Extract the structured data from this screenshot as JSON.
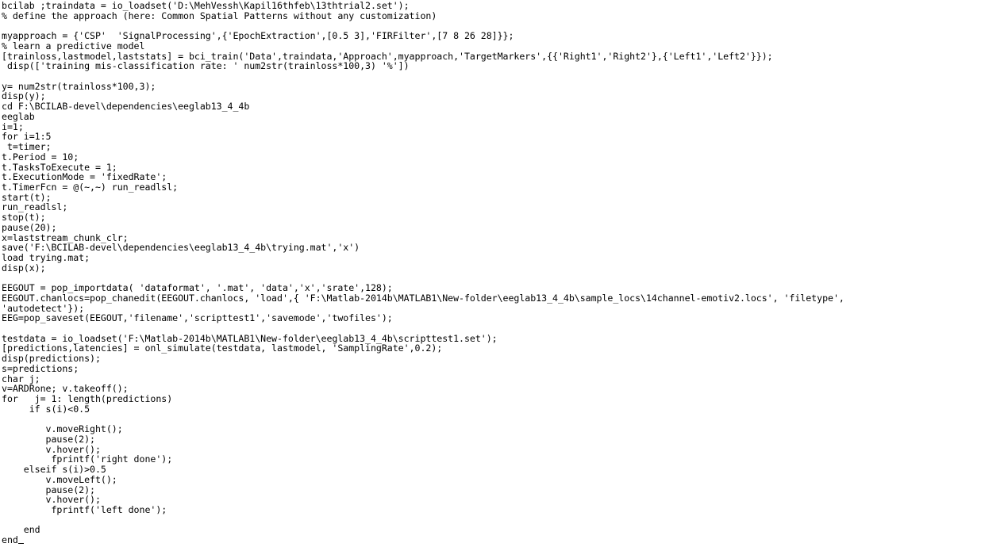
{
  "application": {
    "type": "code-editor",
    "language": "MATLAB",
    "background_color": "#ffffff",
    "text_color": "#000000",
    "font_size_px": 11.6,
    "line_height_px": 12.72
  },
  "editor": {
    "cursor": {
      "glyph": "_",
      "line_index": 53,
      "column": 3
    },
    "lines": [
      "bcilab ;traindata = io_loadset('D:\\MehVessh\\Kapil16thfeb\\13thtrial2.set');",
      "% define the approach (here: Common Spatial Patterns without any customization)",
      "",
      "myapproach = {'CSP'  'SignalProcessing',{'EpochExtraction',[0.5 3],'FIRFilter',[7 8 26 28]}};",
      "% learn a predictive model",
      "[trainloss,lastmodel,laststats] = bci_train('Data',traindata,'Approach',myapproach,'TargetMarkers',{{'Right1','Right2'},{'Left1','Left2'}});",
      " disp(['training mis-classification rate: ' num2str(trainloss*100,3) '%'])",
      "",
      "y= num2str(trainloss*100,3);",
      "disp(y);",
      "cd F:\\BCILAB-devel\\dependencies\\eeglab13_4_4b",
      "eeglab",
      "i=1;",
      "for i=1:5",
      " t=timer;",
      "t.Period = 10;",
      "t.TasksToExecute = 1;",
      "t.ExecutionMode = 'fixedRate';",
      "t.TimerFcn = @(~,~) run_readlsl;",
      "start(t);",
      "run_readlsl;",
      "stop(t);",
      "pause(20);",
      "x=laststream_chunk_clr;",
      "save('F:\\BCILAB-devel\\dependencies\\eeglab13_4_4b\\trying.mat','x')",
      "load trying.mat;",
      "disp(x);",
      "",
      "EEGOUT = pop_importdata( 'dataformat', '.mat', 'data','x','srate',128);",
      "EEGOUT.chanlocs=pop_chanedit(EEGOUT.chanlocs, 'load',{ 'F:\\Matlab-2014b\\MATLAB1\\New-folder\\eeglab13_4_4b\\sample_locs\\14channel-emotiv2.locs', 'filetype',",
      "'autodetect'});",
      "EEG=pop_saveset(EEGOUT,'filename','scripttest1','savemode','twofiles');",
      "",
      "testdata = io_loadset('F:\\Matlab-2014b\\MATLAB1\\New-folder\\eeglab13_4_4b\\scripttest1.set');",
      "[predictions,latencies] = onl_simulate(testdata, lastmodel, 'SamplingRate',0.2);",
      "disp(predictions);",
      "s=predictions;",
      "char j;",
      "v=ARDRone; v.takeoff();",
      "for   j= 1: length(predictions)",
      "     if s(i)<0.5",
      "",
      "        v.moveRight();",
      "        pause(2);",
      "        v.hover();",
      "         fprintf('right done');",
      "    elseif s(i)>0.5",
      "        v.moveLeft();",
      "        pause(2);",
      "        v.hover();",
      "         fprintf('left done');",
      "",
      "    end",
      "end"
    ]
  }
}
